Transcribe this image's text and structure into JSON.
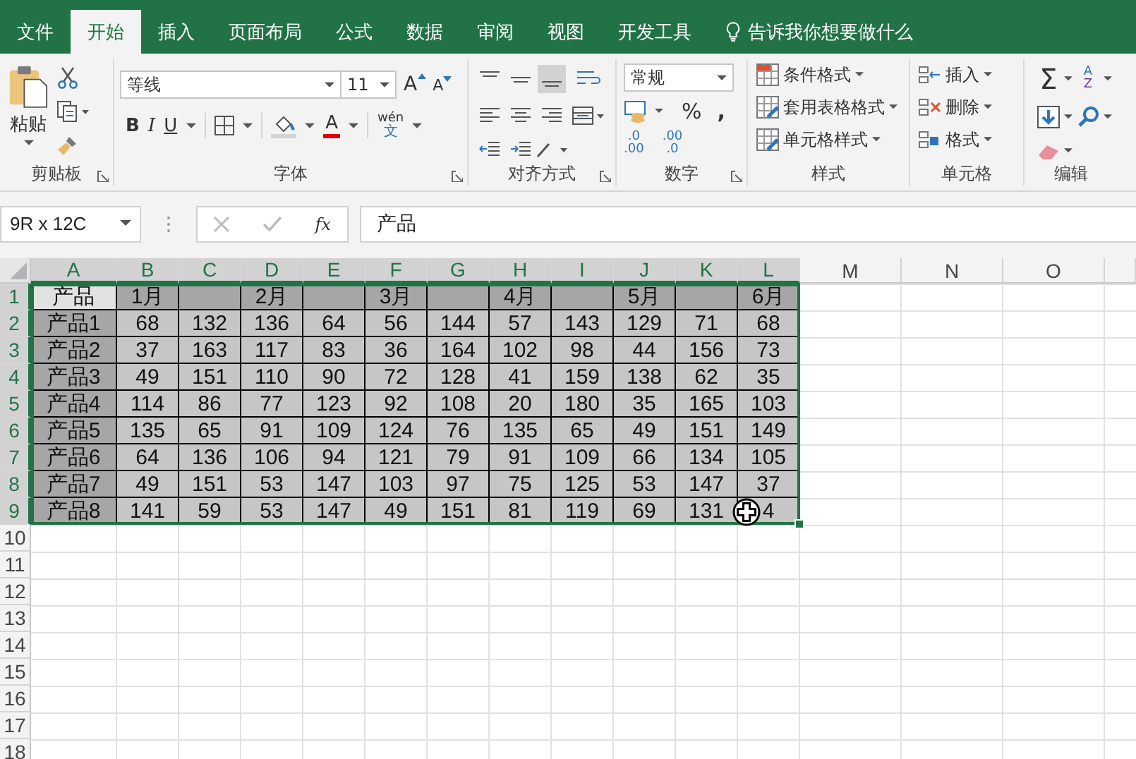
{
  "tabs": [
    {
      "label": "文件",
      "selected": false
    },
    {
      "label": "开始",
      "selected": true
    },
    {
      "label": "插入",
      "selected": false
    },
    {
      "label": "页面布局",
      "selected": false
    },
    {
      "label": "公式",
      "selected": false
    },
    {
      "label": "数据",
      "selected": false
    },
    {
      "label": "审阅",
      "selected": false
    },
    {
      "label": "视图",
      "selected": false
    },
    {
      "label": "开发工具",
      "selected": false
    }
  ],
  "tell_me": "告诉我你想要做什么",
  "clipboard": {
    "paste": "粘贴",
    "label": "剪贴板"
  },
  "font": {
    "name": "等线",
    "size": "11",
    "bold": "B",
    "italic": "I",
    "underline": "U",
    "color_letter": "A",
    "grow": "A",
    "shrink": "A",
    "phonetic_top": "wén",
    "phonetic_bottom": "文",
    "label": "字体"
  },
  "alignment": {
    "label": "对齐方式"
  },
  "number": {
    "format": "常规",
    "percent": "%",
    "comma": ",",
    "inc_top": ".0",
    "inc_bottom": ".00",
    "dec_top": ".00",
    "dec_bottom": ".0",
    "label": "数字"
  },
  "styles": {
    "items": [
      "条件格式",
      "套用表格格式",
      "单元格样式"
    ],
    "label": "样式"
  },
  "cells": {
    "items": [
      "插入",
      "删除",
      "格式"
    ],
    "label": "单元格"
  },
  "editing": {
    "sum": "Σ",
    "sort_top": "A",
    "sort_bottom": "Z",
    "label": "编辑"
  },
  "name_box": "9R x 12C",
  "formula_bar": {
    "fx": "fx",
    "value": "产品"
  },
  "columns": [
    {
      "label": "A",
      "selected": true
    },
    {
      "label": "B",
      "selected": true
    },
    {
      "label": "C",
      "selected": true
    },
    {
      "label": "D",
      "selected": true
    },
    {
      "label": "E",
      "selected": true
    },
    {
      "label": "F",
      "selected": true
    },
    {
      "label": "G",
      "selected": true
    },
    {
      "label": "H",
      "selected": true
    },
    {
      "label": "I",
      "selected": true
    },
    {
      "label": "J",
      "selected": true
    },
    {
      "label": "K",
      "selected": true
    },
    {
      "label": "L",
      "selected": true
    },
    {
      "label": "M",
      "selected": false
    },
    {
      "label": "N",
      "selected": false
    },
    {
      "label": "O",
      "selected": false
    }
  ],
  "rows": [
    {
      "label": "1",
      "selected": true,
      "cells": [
        "产品",
        "1月",
        "",
        "2月",
        "",
        "3月",
        "",
        "4月",
        "",
        "5月",
        "",
        "6月"
      ]
    },
    {
      "label": "2",
      "selected": true,
      "cells": [
        "产品1",
        "68",
        "132",
        "136",
        "64",
        "56",
        "144",
        "57",
        "143",
        "129",
        "71",
        "68"
      ]
    },
    {
      "label": "3",
      "selected": true,
      "cells": [
        "产品2",
        "37",
        "163",
        "117",
        "83",
        "36",
        "164",
        "102",
        "98",
        "44",
        "156",
        "73"
      ]
    },
    {
      "label": "4",
      "selected": true,
      "cells": [
        "产品3",
        "49",
        "151",
        "110",
        "90",
        "72",
        "128",
        "41",
        "159",
        "138",
        "62",
        "35"
      ]
    },
    {
      "label": "5",
      "selected": true,
      "cells": [
        "产品4",
        "114",
        "86",
        "77",
        "123",
        "92",
        "108",
        "20",
        "180",
        "35",
        "165",
        "103"
      ]
    },
    {
      "label": "6",
      "selected": true,
      "cells": [
        "产品5",
        "135",
        "65",
        "91",
        "109",
        "124",
        "76",
        "135",
        "65",
        "49",
        "151",
        "149"
      ]
    },
    {
      "label": "7",
      "selected": true,
      "cells": [
        "产品6",
        "64",
        "136",
        "106",
        "94",
        "121",
        "79",
        "91",
        "109",
        "66",
        "134",
        "105"
      ]
    },
    {
      "label": "8",
      "selected": true,
      "cells": [
        "产品7",
        "49",
        "151",
        "53",
        "147",
        "103",
        "97",
        "75",
        "125",
        "53",
        "147",
        "37"
      ]
    },
    {
      "label": "9",
      "selected": true,
      "cells": [
        "产品8",
        "141",
        "59",
        "53",
        "147",
        "49",
        "151",
        "81",
        "119",
        "69",
        "131",
        "4"
      ]
    },
    {
      "label": "10",
      "selected": false,
      "cells": []
    },
    {
      "label": "11",
      "selected": false,
      "cells": []
    },
    {
      "label": "12",
      "selected": false,
      "cells": []
    },
    {
      "label": "13",
      "selected": false,
      "cells": []
    },
    {
      "label": "14",
      "selected": false,
      "cells": []
    },
    {
      "label": "15",
      "selected": false,
      "cells": []
    },
    {
      "label": "16",
      "selected": false,
      "cells": []
    },
    {
      "label": "17",
      "selected": false,
      "cells": []
    },
    {
      "label": "18",
      "selected": false,
      "cells": []
    }
  ]
}
